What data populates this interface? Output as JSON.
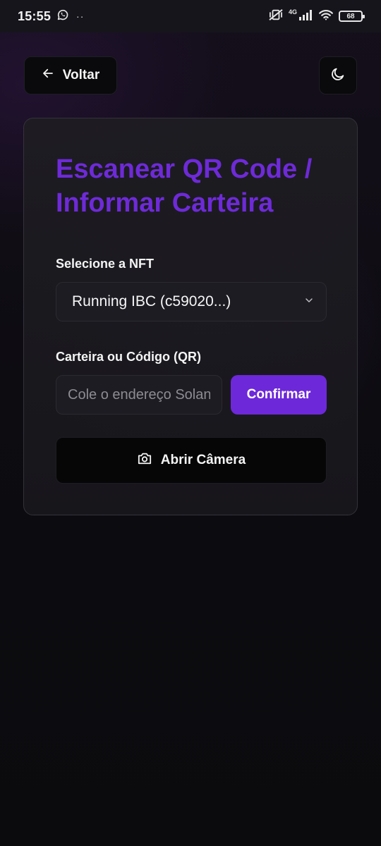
{
  "status_bar": {
    "time": "15:55",
    "more": "··",
    "network": "4G",
    "battery": "68",
    "icons": [
      "whatsapp-icon",
      "vibrate-off-icon",
      "signal-icon",
      "wifi-icon",
      "battery-icon"
    ]
  },
  "header": {
    "back_label": "Voltar",
    "back_icon": "arrow-left-icon",
    "theme_icon": "moon-icon"
  },
  "card": {
    "title": "Escanear QR Code / Informar Carteira",
    "nft_label": "Selecione a NFT",
    "nft_selected": "Running IBC (c59020...)",
    "wallet_label": "Carteira ou Código (QR)",
    "wallet_placeholder": "Cole o endereço Solana",
    "wallet_value": "",
    "confirm_label": "Confirmar",
    "camera_label": "Abrir Câmera",
    "camera_icon": "camera-icon"
  },
  "colors": {
    "accent": "#6d28d9",
    "title": "#6e2ad8",
    "background": "#0b0b0e"
  }
}
